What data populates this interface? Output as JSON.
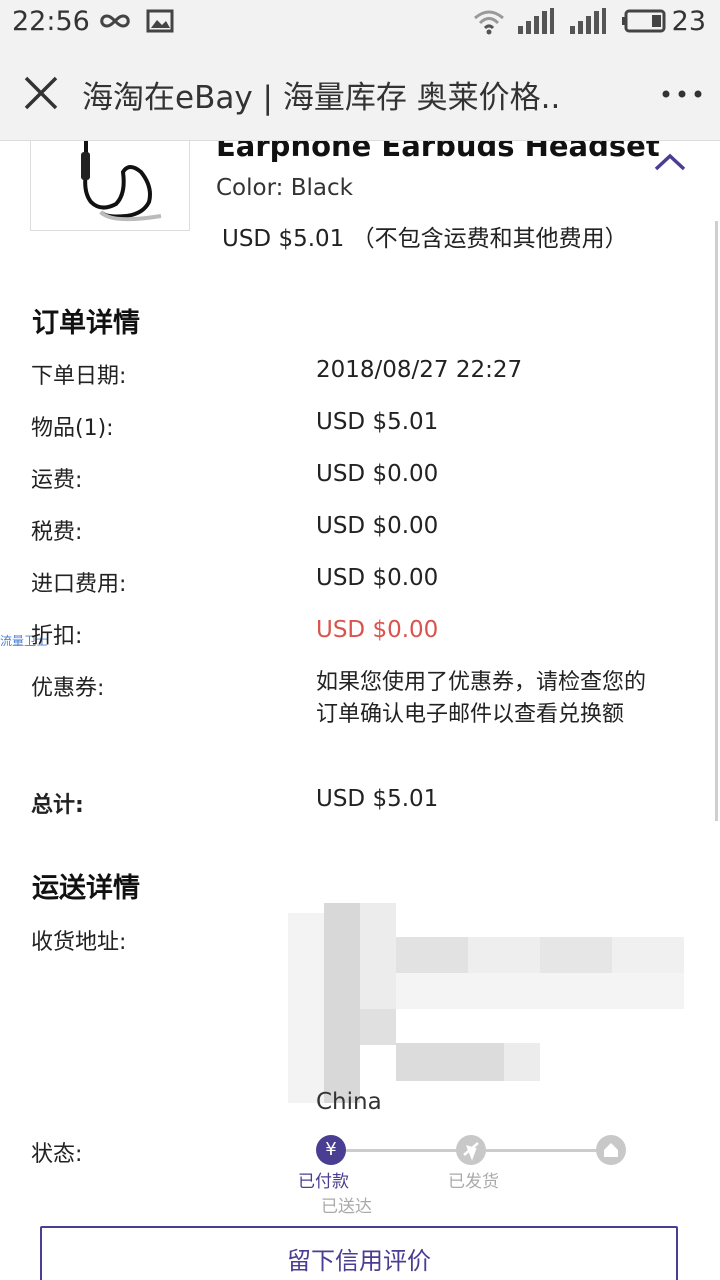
{
  "status_bar": {
    "time": "22:56",
    "battery_level": "23",
    "icons": [
      "infinity-icon",
      "image-icon",
      "wifi-icon",
      "signal-icon",
      "signal-icon",
      "battery-icon"
    ]
  },
  "title_bar": {
    "title": "海淘在eBay | 海量库存 奥莱价格.."
  },
  "product": {
    "title": "Earphone Earbuds Headset",
    "color": "Color: Black",
    "price": "USD $5.01 （不包含运费和其他费用）"
  },
  "order_details": {
    "section_title": "订单详情",
    "rows": [
      {
        "label": "下单日期:",
        "value": "2018/08/27 22:27"
      },
      {
        "label": "物品(1):",
        "value": "USD $5.01"
      },
      {
        "label": "运费:",
        "value": "USD $0.00"
      },
      {
        "label": "税费:",
        "value": "USD $0.00"
      },
      {
        "label": "进口费用:",
        "value": "USD $0.00"
      },
      {
        "label": "折扣:",
        "value": "USD $0.00"
      },
      {
        "label": "优惠券:",
        "value": "如果您使用了优惠券，请检查您的订单确认电子邮件以查看兑换额"
      },
      {
        "label": "总计:",
        "value": "USD $5.01"
      }
    ],
    "discount_color": "#d9534f"
  },
  "side_tag": "流量卫士",
  "shipping_details": {
    "section_title": "运送详情",
    "address_label": "收货地址:",
    "address_last_line": "China",
    "status_label": "状态:",
    "steps": [
      {
        "label": "已付款",
        "icon": "yen-icon",
        "active": true
      },
      {
        "label": "已发货",
        "icon": "plane-icon",
        "active": false
      },
      {
        "label": "已送达",
        "icon": "home-icon",
        "active": false
      }
    ]
  },
  "feedback_button": "留下信用评价",
  "colors": {
    "accent": "#4a3e93",
    "inactive": "#c8c8c8",
    "discount": "#d9534f"
  }
}
